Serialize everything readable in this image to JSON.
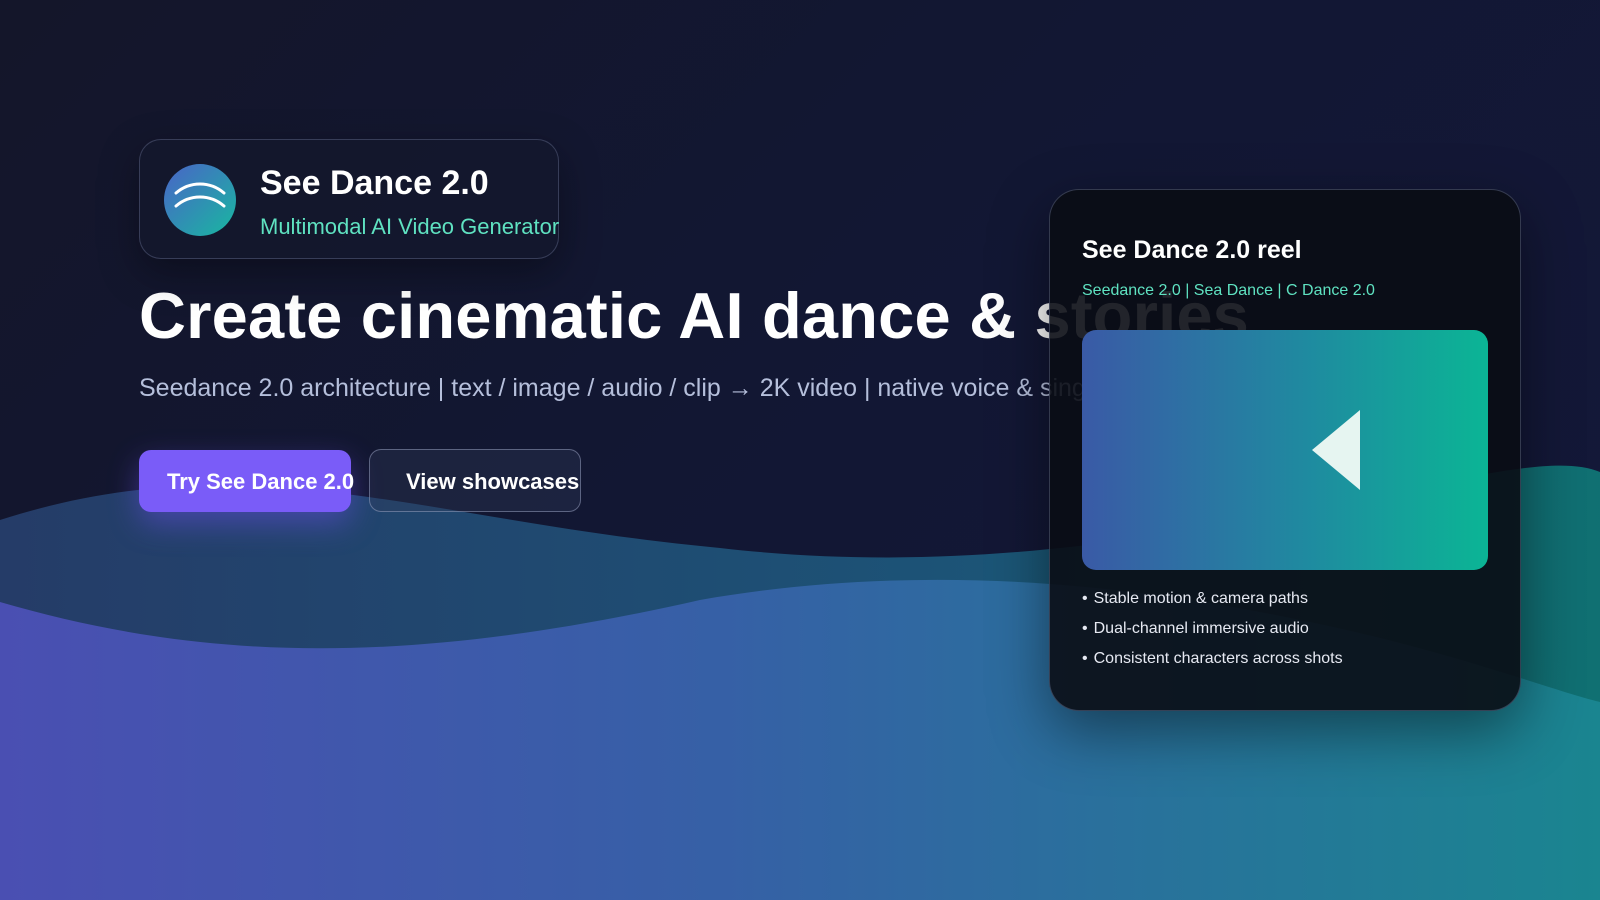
{
  "brand": {
    "name": "See Dance 2.0",
    "tagline": "Multimodal AI Video Generator"
  },
  "hero": {
    "title": "Create cinematic AI dance & stories",
    "subtitle": "Seedance 2.0 architecture | text / image / audio / clip → 2K video | native voice & singing"
  },
  "buttons": {
    "primary_label": "Try See Dance 2.0",
    "secondary_label": "View showcases"
  },
  "reel": {
    "title": "See Dance 2.0 reel",
    "aliases": "Seedance 2.0 | Sea Dance | C Dance 2.0",
    "features": [
      "Stable motion & camera paths",
      "Dual-channel immersive audio",
      "Consistent characters across shots"
    ]
  },
  "colors": {
    "background": "#13162e",
    "accent_purple": "#7a5cf8",
    "accent_teal": "#5fe2c1",
    "wave_purple": "#4b4fb0",
    "wave_teal": "#1a8a8e"
  },
  "icons": {
    "brand_logo": "signal-waves-icon",
    "video_play": "play-icon"
  }
}
